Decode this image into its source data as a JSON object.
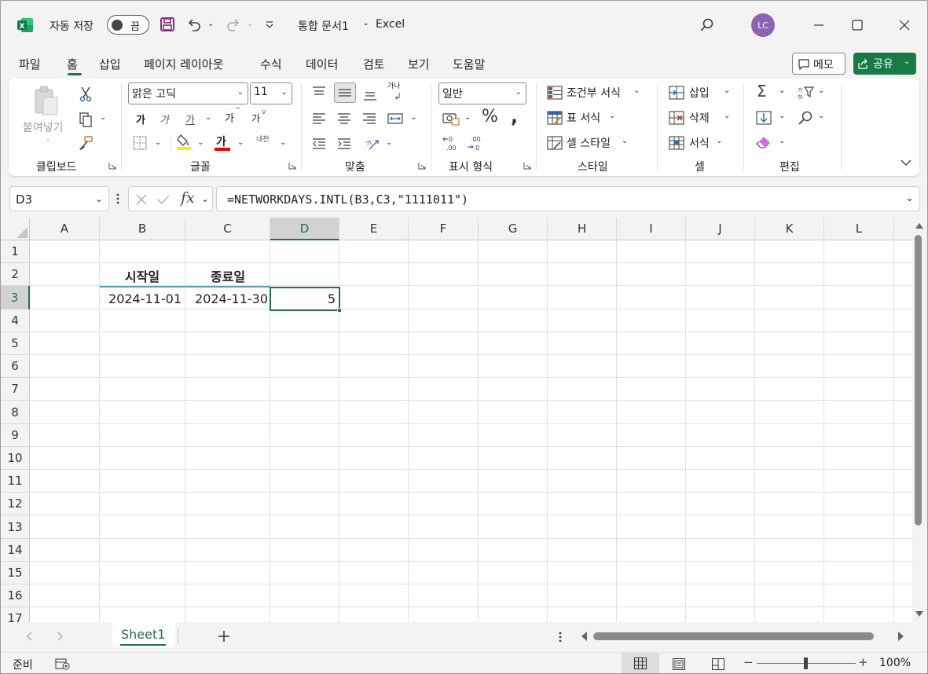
{
  "titlebar": {
    "autosave_label": "자동 저장",
    "autosave_state": "끔",
    "doc_title": "통합 문서1",
    "separator": "-",
    "app_name": "Excel",
    "avatar_initials": "LC"
  },
  "menu": {
    "tabs": [
      "파일",
      "홈",
      "삽입",
      "페이지 레이아웃",
      "수식",
      "데이터",
      "검토",
      "보기",
      "도움말"
    ],
    "active": "홈",
    "memo_label": "메모",
    "share_label": "공유"
  },
  "ribbon": {
    "clipboard": {
      "paste_label": "붙여넣기",
      "group_label": "클립보드"
    },
    "font": {
      "font_name": "맑은 고딕",
      "font_size": "11",
      "group_label": "글꼴",
      "bold": "가",
      "italic": "가",
      "underline": "가",
      "grow": "가",
      "shrink": "가",
      "font_color_glyph": "가",
      "phonetic": "내천"
    },
    "alignment": {
      "group_label": "맞춤",
      "wrap_glyph": "가나"
    },
    "number": {
      "format": "일반",
      "group_label": "표시 형식"
    },
    "styles": {
      "conditional": "조건부 서식",
      "table": "표 서식",
      "cell_style": "셀 스타일",
      "group_label": "스타일"
    },
    "cells": {
      "insert": "삽입",
      "delete": "삭제",
      "format": "서식",
      "group_label": "셀"
    },
    "editing": {
      "group_label": "편집"
    }
  },
  "formula_bar": {
    "name_box": "D3",
    "formula": "=NETWORKDAYS.INTL(B3,C3,\"1111011\")"
  },
  "grid": {
    "columns": [
      "A",
      "B",
      "C",
      "D",
      "E",
      "F",
      "G",
      "H",
      "I",
      "J",
      "K",
      "L"
    ],
    "rows": [
      "1",
      "2",
      "3",
      "4",
      "5",
      "6",
      "7",
      "8",
      "9",
      "10",
      "11",
      "12",
      "13",
      "14",
      "15",
      "16",
      "17"
    ],
    "cells": {
      "B2": "시작일",
      "C2": "종료일",
      "B3": "2024-11-01",
      "C3": "2024-11-30",
      "D3": "5"
    },
    "selected_cell": "D3",
    "accent_color": "#217346"
  },
  "sheets": {
    "tabs": [
      "Sheet1"
    ],
    "active": "Sheet1"
  },
  "status": {
    "ready": "준비",
    "zoom": "100%"
  }
}
